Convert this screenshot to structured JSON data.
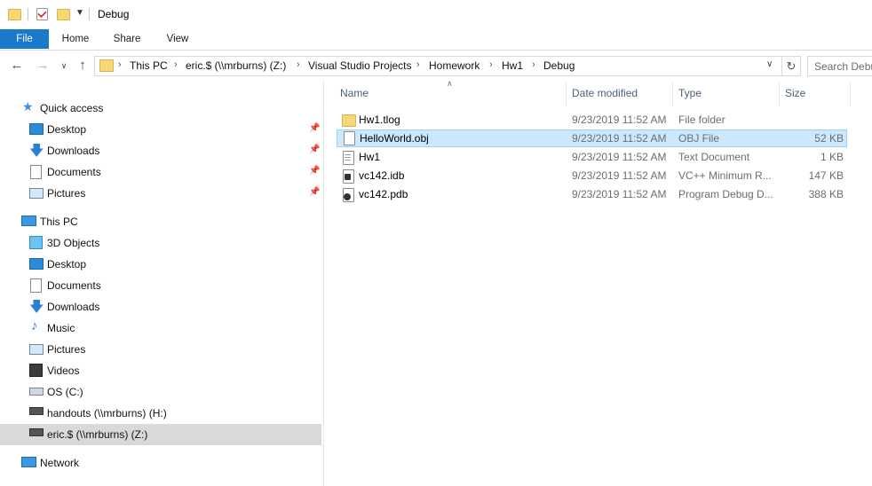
{
  "window": {
    "title": "Debug"
  },
  "ribbon": {
    "tabs": [
      "File",
      "Home",
      "Share",
      "View"
    ]
  },
  "nav": {
    "breadcrumbs": [
      "This PC",
      "eric.$ (\\\\mrburns) (Z:)",
      "Visual Studio Projects",
      "Homework",
      "Hw1",
      "Debug"
    ],
    "search_placeholder": "Search Debug"
  },
  "sidebar": {
    "quick_access": "Quick access",
    "quick_items": [
      "Desktop",
      "Downloads",
      "Documents",
      "Pictures"
    ],
    "this_pc": "This PC",
    "pc_items": [
      "3D Objects",
      "Desktop",
      "Documents",
      "Downloads",
      "Music",
      "Pictures",
      "Videos",
      "OS (C:)",
      "handouts (\\\\mrburns) (H:)",
      "eric.$ (\\\\mrburns) (Z:)"
    ],
    "network": "Network"
  },
  "files": {
    "columns": {
      "name": "Name",
      "date": "Date modified",
      "type": "Type",
      "size": "Size"
    },
    "rows": [
      {
        "name": "Hw1.tlog",
        "date": "9/23/2019 11:52 AM",
        "type": "File folder",
        "size": ""
      },
      {
        "name": "HelloWorld.obj",
        "date": "9/23/2019 11:52 AM",
        "type": "OBJ File",
        "size": "52 KB"
      },
      {
        "name": "Hw1",
        "date": "9/23/2019 11:52 AM",
        "type": "Text Document",
        "size": "1 KB"
      },
      {
        "name": "vc142.idb",
        "date": "9/23/2019 11:52 AM",
        "type": "VC++ Minimum R...",
        "size": "147 KB"
      },
      {
        "name": "vc142.pdb",
        "date": "9/23/2019 11:52 AM",
        "type": "Program Debug D...",
        "size": "388 KB"
      }
    ]
  },
  "colors": {
    "accent": "#1979ca",
    "selection": "#cce8ff",
    "folder": "#f8d775"
  }
}
